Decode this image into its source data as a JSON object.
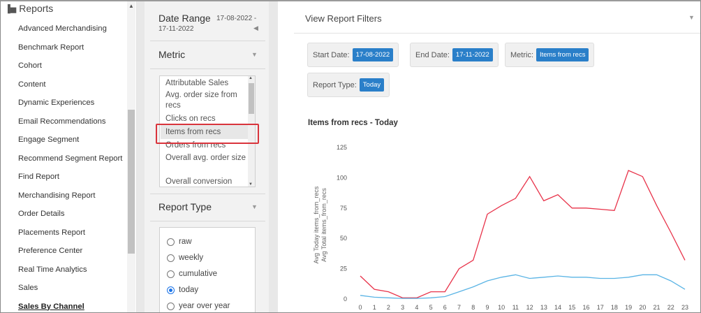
{
  "nav": {
    "header": "Reports",
    "items": [
      "Advanced Merchandising",
      "Benchmark Report",
      "Cohort",
      "Content",
      "Dynamic Experiences",
      "Email Recommendations",
      "Engage Segment",
      "Recommend Segment Report",
      "Find Report",
      "Merchandising Report",
      "Order Details",
      "Placements Report",
      "Preference Center",
      "Real Time Analytics",
      "Sales",
      "Sales By Channel"
    ],
    "active_index": 15
  },
  "filters": {
    "date_range_label": "Date Range",
    "date_range_start": "17-08-2022 -",
    "date_range_end": "17-11-2022",
    "metric_label": "Metric",
    "metric_options": [
      "Attributable Sales",
      "Avg. order size from recs",
      "Clicks on recs",
      "Items from recs",
      "Orders from recs",
      "Overall avg. order size",
      "Overall conversion"
    ],
    "metric_selected": "Items from recs",
    "report_type_label": "Report Type",
    "report_type_options": [
      "raw",
      "weekly",
      "cumulative",
      "today",
      "year over year"
    ],
    "report_type_selected": "today"
  },
  "view_report_filters": {
    "title": "View Report Filters",
    "start_date_label": "Start Date:",
    "start_date_value": "17-08-2022",
    "end_date_label": "End Date:",
    "end_date_value": "17-11-2022",
    "metric_label": "Metric:",
    "metric_value": "Items from recs",
    "report_type_label": "Report Type:",
    "report_type_value": "Today"
  },
  "colors": {
    "accent": "#2a7fc9",
    "highlight_border": "#d9343c",
    "series_today": "#e8334a",
    "series_total": "#5ab4e5"
  },
  "chart_data": {
    "type": "line",
    "title": "Items from recs - Today",
    "xlabel": "",
    "ylabel_lines": [
      "Avg Today items_from_recs",
      "Avg Total items_from_recs"
    ],
    "x": [
      0,
      1,
      2,
      3,
      4,
      5,
      6,
      7,
      8,
      9,
      10,
      11,
      12,
      13,
      14,
      15,
      16,
      17,
      18,
      19,
      20,
      21,
      22,
      23
    ],
    "ylim": [
      0,
      125
    ],
    "yticks": [
      0,
      25,
      50,
      75,
      100,
      125
    ],
    "series": [
      {
        "name": "Avg Today items_from_recs",
        "color": "#e8334a",
        "values": [
          19,
          8,
          6,
          1,
          1,
          6,
          6,
          25,
          32,
          70,
          77,
          83,
          101,
          81,
          86,
          75,
          75,
          74,
          73,
          106,
          101,
          77,
          55,
          32
        ]
      },
      {
        "name": "Avg Total items_from_recs",
        "color": "#5ab4e5",
        "values": [
          3,
          1.5,
          1,
          0.5,
          0.5,
          1,
          2,
          6,
          10,
          15,
          18,
          20,
          17,
          18,
          19,
          18,
          18,
          17,
          17,
          18,
          20,
          20,
          15,
          8
        ]
      }
    ]
  }
}
